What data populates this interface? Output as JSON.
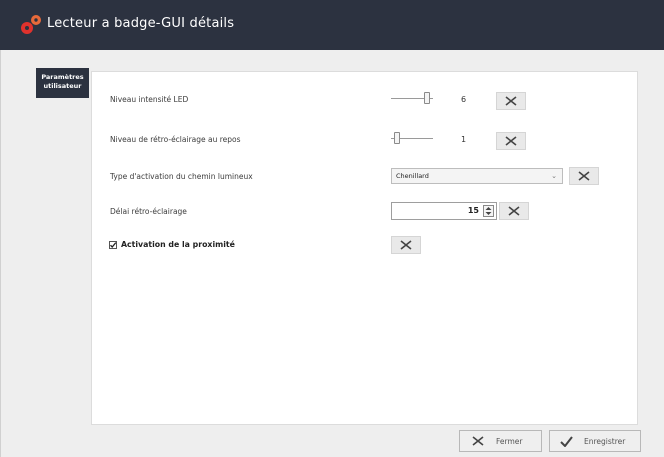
{
  "window": {
    "title": "Lecteur a badge-GUI détails",
    "logo_icon": "gear-pair-icon",
    "accent_color": "#e0322d"
  },
  "side_tab": {
    "label_line1": "Paramètres",
    "label_line2": "utilisateur"
  },
  "settings": {
    "led_intensity": {
      "label": "Niveau intensité LED",
      "value": "6"
    },
    "backlight_idle": {
      "label": "Niveau de rétro-éclairage au repos",
      "value": "1"
    },
    "light_path_type": {
      "label": "Type d'activation du chemin lumineux",
      "selected": "Chenillard"
    },
    "backlight_delay": {
      "label": "Délai rétro-éclairage",
      "value": "15"
    },
    "proximity": {
      "label": "Activation de la proximité",
      "checked": true
    }
  },
  "icons": {
    "reset": "close-x-icon",
    "spinner": "spin-updown-icon",
    "caret": "chevron-down-icon",
    "checkmark": "checkmark-icon"
  },
  "footer": {
    "close_label": "Fermer",
    "save_label": "Enregistrer"
  }
}
